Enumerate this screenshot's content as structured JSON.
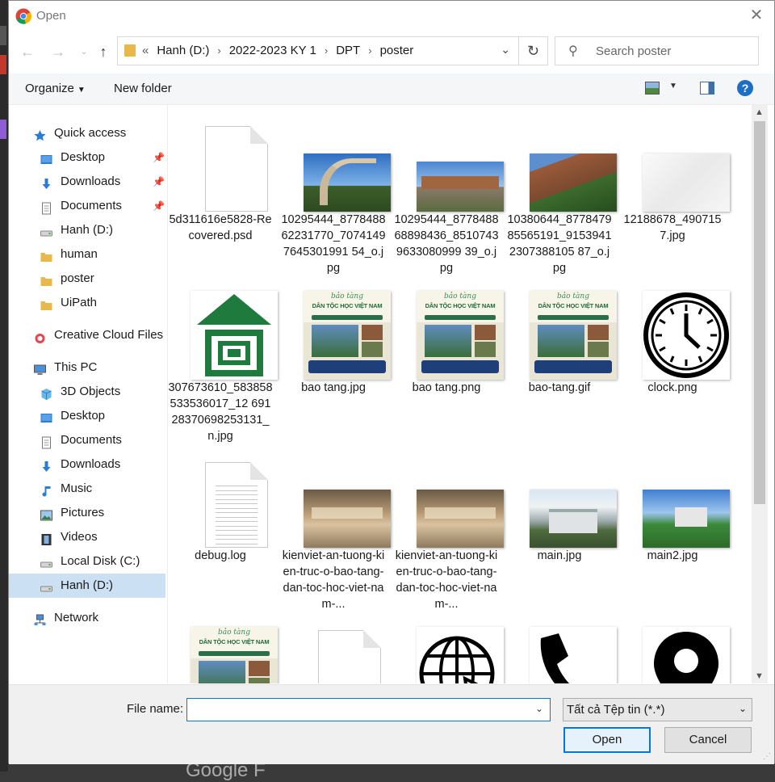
{
  "window": {
    "title": "Open"
  },
  "address": {
    "crumbs": [
      "Hanh (D:)",
      "2022-2023 KY 1",
      "DPT",
      "poster"
    ],
    "overflow": "«"
  },
  "search": {
    "placeholder": "Search poster"
  },
  "toolbar": {
    "organize": "Organize",
    "new_folder": "New folder",
    "help": "?"
  },
  "sidebar": [
    {
      "label": "Quick access",
      "icon": "star-icon",
      "indent": 0
    },
    {
      "label": "Desktop",
      "icon": "desktop-folder-icon",
      "indent": 1,
      "pinned": true
    },
    {
      "label": "Downloads",
      "icon": "download-arrow-icon",
      "indent": 1,
      "pinned": true
    },
    {
      "label": "Documents",
      "icon": "documents-icon",
      "indent": 1,
      "pinned": true
    },
    {
      "label": "Hanh (D:)",
      "icon": "drive-icon",
      "indent": 1
    },
    {
      "label": "human",
      "icon": "folder-icon",
      "indent": 1
    },
    {
      "label": "poster",
      "icon": "folder-icon",
      "indent": 1
    },
    {
      "label": "UiPath",
      "icon": "folder-icon",
      "indent": 1
    },
    {
      "label": "Creative Cloud Files",
      "icon": "creative-cloud-icon",
      "indent": 0
    },
    {
      "label": "This PC",
      "icon": "computer-icon",
      "indent": 0
    },
    {
      "label": "3D Objects",
      "icon": "cube-icon",
      "indent": 1
    },
    {
      "label": "Desktop",
      "icon": "desktop-folder-icon",
      "indent": 1
    },
    {
      "label": "Documents",
      "icon": "documents-icon",
      "indent": 1
    },
    {
      "label": "Downloads",
      "icon": "download-arrow-icon",
      "indent": 1
    },
    {
      "label": "Music",
      "icon": "music-note-icon",
      "indent": 1
    },
    {
      "label": "Pictures",
      "icon": "pictures-icon",
      "indent": 1
    },
    {
      "label": "Videos",
      "icon": "film-icon",
      "indent": 1
    },
    {
      "label": "Local Disk (C:)",
      "icon": "drive-icon",
      "indent": 1
    },
    {
      "label": "Hanh (D:)",
      "icon": "drive-icon",
      "indent": 1,
      "selected": true
    },
    {
      "label": "Network",
      "icon": "network-icon",
      "indent": 0
    }
  ],
  "files": [
    {
      "name": "5d311616e5828-Recovered.psd",
      "kind": "blank-doc"
    },
    {
      "name": "10295444_877848862231770_70741497645301991 54_o.jpg",
      "kind": "photo-arch"
    },
    {
      "name": "10295444_877848868898436_85107439633080999 39_o.jpg",
      "kind": "photo-building"
    },
    {
      "name": "10380644_877847985565191_91539412307388105 87_o.jpg",
      "kind": "photo-brick"
    },
    {
      "name": "12188678_4907157.jpg",
      "kind": "photo-white"
    },
    {
      "name": "307673610_583858533536017_12 69128370698253131_n.jpg",
      "kind": "logo-green"
    },
    {
      "name": "bao tang.jpg",
      "kind": "poster"
    },
    {
      "name": "bao tang.png",
      "kind": "poster"
    },
    {
      "name": "bao-tang.gif",
      "kind": "poster"
    },
    {
      "name": "clock.png",
      "kind": "clock"
    },
    {
      "name": "debug.log",
      "kind": "text-doc"
    },
    {
      "name": "kienviet-an-tuong-kien-truc-o-bao-tang-dan-toc-hoc-viet-nam-...",
      "kind": "photo-interior"
    },
    {
      "name": "kienviet-an-tuong-kien-truc-o-bao-tang-dan-toc-hoc-viet-nam-...",
      "kind": "photo-interior"
    },
    {
      "name": "main.jpg",
      "kind": "photo-main"
    },
    {
      "name": "main2.jpg",
      "kind": "photo-main2"
    },
    {
      "name": "",
      "kind": "poster"
    },
    {
      "name": "",
      "kind": "blank-doc"
    },
    {
      "name": "",
      "kind": "globe"
    },
    {
      "name": "",
      "kind": "phone"
    },
    {
      "name": "",
      "kind": "pin"
    }
  ],
  "poster_text": {
    "line1": "bảo tàng",
    "line2": "DÂN TỘC HỌC VIỆT NAM"
  },
  "bottom": {
    "file_name_label": "File name:",
    "file_name_value": "",
    "filter": "Tất cả Tệp tin (*.*)",
    "open": "Open",
    "cancel": "Cancel"
  },
  "colors": {
    "accent": "#0078d7",
    "selection": "#cce0f4",
    "folder": "#e8b84a",
    "help": "#1e6fc4"
  },
  "background": {
    "peek_text": "Google F"
  }
}
